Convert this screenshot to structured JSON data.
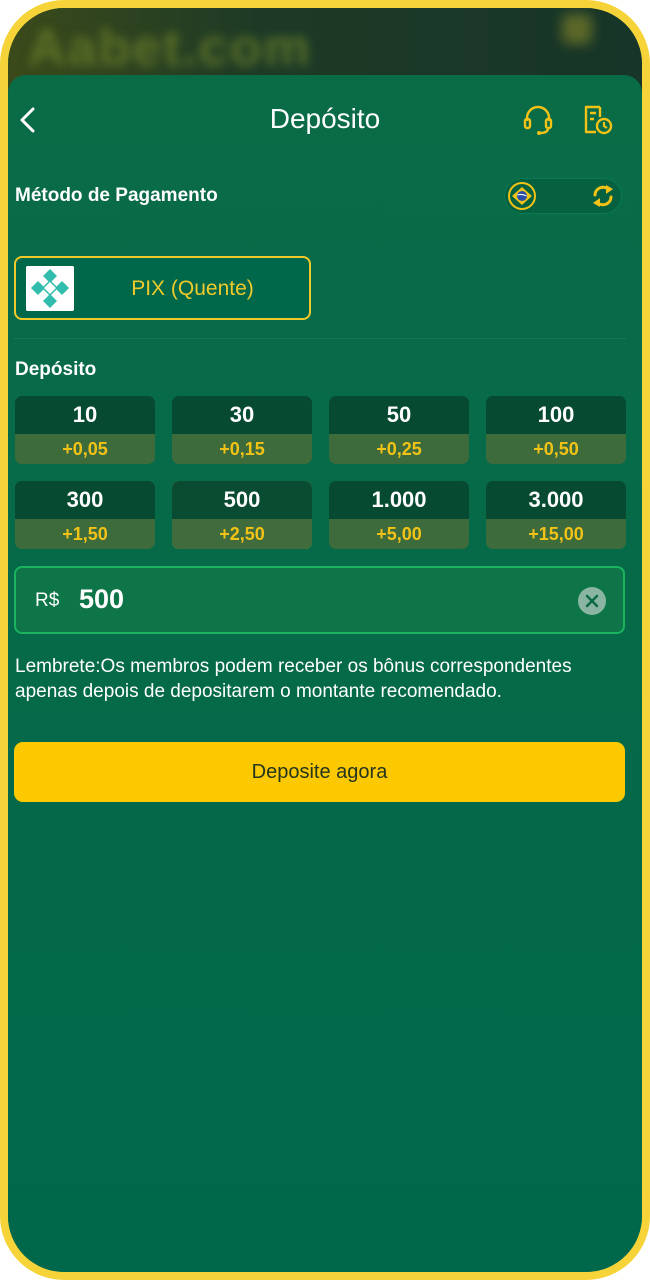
{
  "background": {
    "brand_text": "Aabet.com"
  },
  "header": {
    "title": "Depósito",
    "back_icon": "chevron-left-icon",
    "support_icon": "headset-icon",
    "history_icon": "receipt-clock-icon"
  },
  "payment": {
    "label": "Método de Pagamento",
    "currency_toggle": {
      "left_icon": "brazil-flag-icon",
      "right_icon": "refresh-icon"
    },
    "method": {
      "name": "PIX (Quente)",
      "logo": "pix-logo-icon"
    }
  },
  "deposit": {
    "label": "Depósito",
    "options": [
      {
        "amount": "10",
        "bonus": "+0,05"
      },
      {
        "amount": "30",
        "bonus": "+0,15"
      },
      {
        "amount": "50",
        "bonus": "+0,25"
      },
      {
        "amount": "100",
        "bonus": "+0,50"
      },
      {
        "amount": "300",
        "bonus": "+1,50"
      },
      {
        "amount": "500",
        "bonus": "+2,50"
      },
      {
        "amount": "1.000",
        "bonus": "+5,00"
      },
      {
        "amount": "3.000",
        "bonus": "+15,00"
      }
    ],
    "selected_index": 5,
    "currency": "R$",
    "value": "500",
    "reminder": "Lembrete:Os membros podem receber os bônus correspondentes apenas depois de depositarem o montante recomendado.",
    "submit_label": "Deposite agora"
  },
  "colors": {
    "accent": "#fcc800",
    "background": "#00684a",
    "bonus": "#f2c316",
    "input_border": "#1bb35d"
  }
}
